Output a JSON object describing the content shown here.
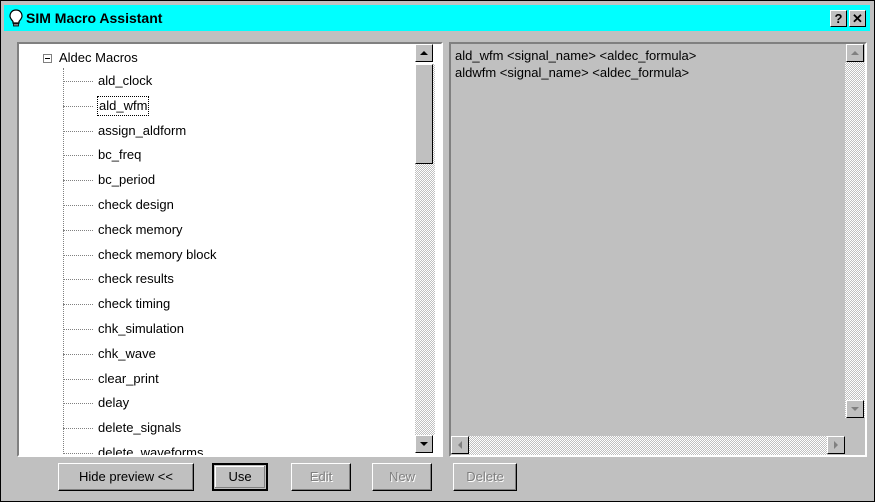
{
  "window": {
    "title": "SIM Macro Assistant",
    "help_label": "?",
    "close_label": "✕",
    "title_bar_color": "#00ffff"
  },
  "tree": {
    "root_label": "Aldec Macros",
    "selected_index": 1,
    "items": [
      {
        "label": "ald_clock"
      },
      {
        "label": "ald_wfm"
      },
      {
        "label": "assign_aldform"
      },
      {
        "label": "bc_freq"
      },
      {
        "label": "bc_period"
      },
      {
        "label": "check design"
      },
      {
        "label": "check memory"
      },
      {
        "label": "check memory block"
      },
      {
        "label": "check results"
      },
      {
        "label": "check timing"
      },
      {
        "label": "chk_simulation"
      },
      {
        "label": "chk_wave"
      },
      {
        "label": "clear_print"
      },
      {
        "label": "delay"
      },
      {
        "label": "delete_signals"
      },
      {
        "label": "delete_waveforms"
      }
    ]
  },
  "preview": {
    "lines": [
      "ald_wfm <signal_name> <aldec_formula>",
      "aldwfm <signal_name> <aldec_formula>"
    ]
  },
  "buttons": {
    "hide_preview": "Hide preview <<",
    "use": "Use",
    "edit": "Edit",
    "new": "New",
    "delete": "Delete"
  }
}
